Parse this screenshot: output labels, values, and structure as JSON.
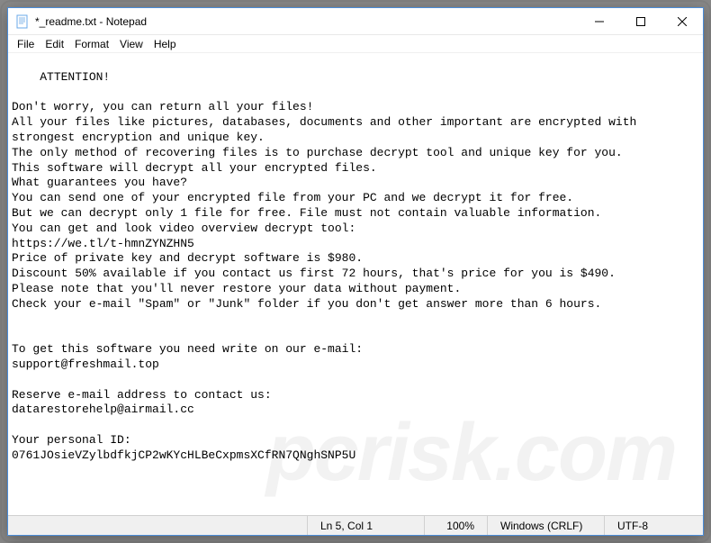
{
  "titlebar": {
    "title": "*_readme.txt - Notepad"
  },
  "menu": {
    "file": "File",
    "edit": "Edit",
    "format": "Format",
    "view": "View",
    "help": "Help"
  },
  "document": {
    "content": "ATTENTION!\n\nDon't worry, you can return all your files!\nAll your files like pictures, databases, documents and other important are encrypted with strongest encryption and unique key.\nThe only method of recovering files is to purchase decrypt tool and unique key for you.\nThis software will decrypt all your encrypted files.\nWhat guarantees you have?\nYou can send one of your encrypted file from your PC and we decrypt it for free.\nBut we can decrypt only 1 file for free. File must not contain valuable information.\nYou can get and look video overview decrypt tool:\nhttps://we.tl/t-hmnZYNZHN5\nPrice of private key and decrypt software is $980.\nDiscount 50% available if you contact us first 72 hours, that's price for you is $490.\nPlease note that you'll never restore your data without payment.\nCheck your e-mail \"Spam\" or \"Junk\" folder if you don't get answer more than 6 hours.\n\n\nTo get this software you need write on our e-mail:\nsupport@freshmail.top\n\nReserve e-mail address to contact us:\ndatarestorehelp@airmail.cc\n\nYour personal ID:\n0761JOsieVZylbdfkjCP2wKYcHLBeCxpmsXCfRN7QNghSNP5U"
  },
  "statusbar": {
    "position": "Ln 5, Col 1",
    "zoom": "100%",
    "line_ending": "Windows (CRLF)",
    "encoding": "UTF-8"
  },
  "watermark": "pcrisk.com"
}
